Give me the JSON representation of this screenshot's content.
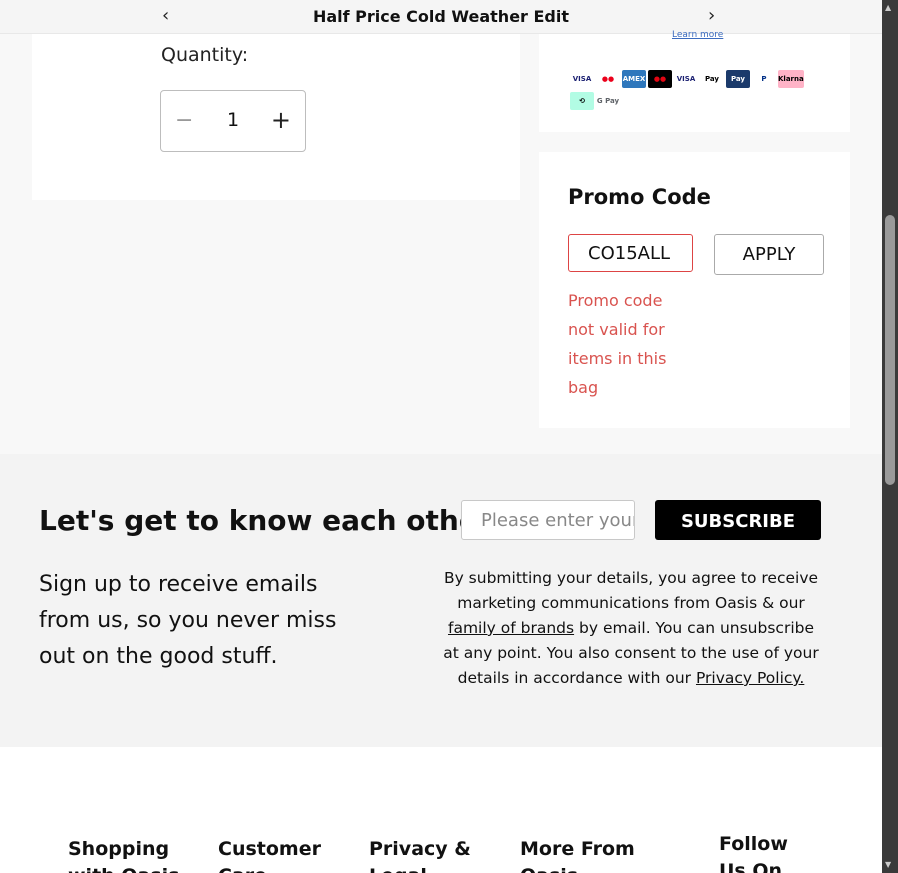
{
  "banner": {
    "title": "Half Price Cold Weather Edit",
    "prev_arrow": "‹",
    "next_arrow": "›"
  },
  "quantity": {
    "label": "Quantity:",
    "value": "1",
    "minus": "−",
    "plus": "+"
  },
  "payment": {
    "learn_more": "Learn more",
    "methods": [
      {
        "name": "visa-icon",
        "label": "VISA",
        "bg": "#ffffff",
        "fg": "#1a1f71"
      },
      {
        "name": "mastercard-icon",
        "label": "●●",
        "bg": "#ffffff",
        "fg": "#eb001b"
      },
      {
        "name": "amex-icon",
        "label": "AMEX",
        "bg": "#2e77bc",
        "fg": "#ffffff"
      },
      {
        "name": "maestro-icon",
        "label": "●●",
        "bg": "#000000",
        "fg": "#e30613"
      },
      {
        "name": "visa-electron-icon",
        "label": "VISA",
        "bg": "#ffffff",
        "fg": "#1a1f71"
      },
      {
        "name": "apple-pay-icon",
        "label": "Pay",
        "bg": "#ffffff",
        "fg": "#000000"
      },
      {
        "name": "pay-icon",
        "label": "Pay",
        "bg": "#1b3a6b",
        "fg": "#ffffff"
      },
      {
        "name": "paypal-icon",
        "label": "P",
        "bg": "#ffffff",
        "fg": "#003087"
      },
      {
        "name": "klarna-icon",
        "label": "Klarna",
        "bg": "#ffb3c7",
        "fg": "#000000"
      },
      {
        "name": "clearpay-icon",
        "label": "⟲",
        "bg": "#b2fce4",
        "fg": "#000000"
      },
      {
        "name": "google-pay-icon",
        "label": "G Pay",
        "bg": "#ffffff",
        "fg": "#5f6368"
      }
    ]
  },
  "promo": {
    "title": "Promo Code",
    "input_value": "CO15ALL",
    "apply_label": "APPLY",
    "error": "Promo code not valid for items in this bag"
  },
  "newsletter": {
    "heading": "Let's get to know each other",
    "email_placeholder": "Please enter your email",
    "subscribe_label": "SUBSCRIBE",
    "subtext": "Sign up to receive emails from us, so you never miss out on the good stuff.",
    "legal_part1": "By submitting your details, you agree to receive marketing communications from Oasis & our ",
    "legal_link1": "family of brands",
    "legal_part2": " by email. You can unsubscribe at any point. You also consent to the use of your details in accordance with our ",
    "legal_link2": "Privacy Policy."
  },
  "footer": {
    "columns": [
      "Shopping with Oasis",
      "Customer Care",
      "Privacy & Legal",
      "More From Oasis",
      "Follow Us On Social"
    ]
  },
  "colors": {
    "error": "#d9534f",
    "subscribe_bg": "#000000"
  }
}
